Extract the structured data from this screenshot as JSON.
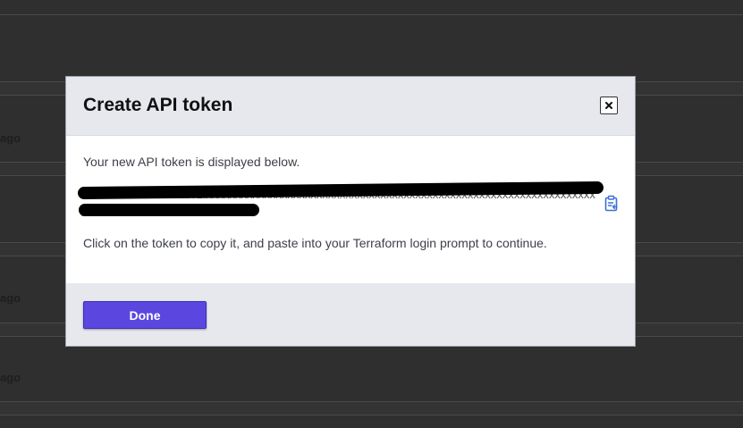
{
  "background": {
    "rows": [
      {
        "time_label": ""
      },
      {
        "time_label": "ago"
      },
      {
        "time_label": ""
      },
      {
        "time_label": "ago"
      },
      {
        "time_label": "ago"
      }
    ]
  },
  "modal": {
    "title": "Create API token",
    "close_label": "×",
    "intro": "Your new API token is displayed below.",
    "token": "xxxxxxxxxxxxxx.atlasv1.xxxxxxxxxxxxxxxxxxxxxxxxxxxxxxxxxxxxxxxxxxxxxxxxxxxxxxxxxxxxxxxxxxxx",
    "copy_icon": "clipboard-icon",
    "instructions": "Click on the token to copy it, and paste into your Terraform login prompt to continue.",
    "done_label": "Done"
  },
  "colors": {
    "accent": "#5b47e0",
    "overlay": "#333333",
    "header_bg": "#e6e8ee",
    "copy_icon": "#3b6fd6"
  }
}
